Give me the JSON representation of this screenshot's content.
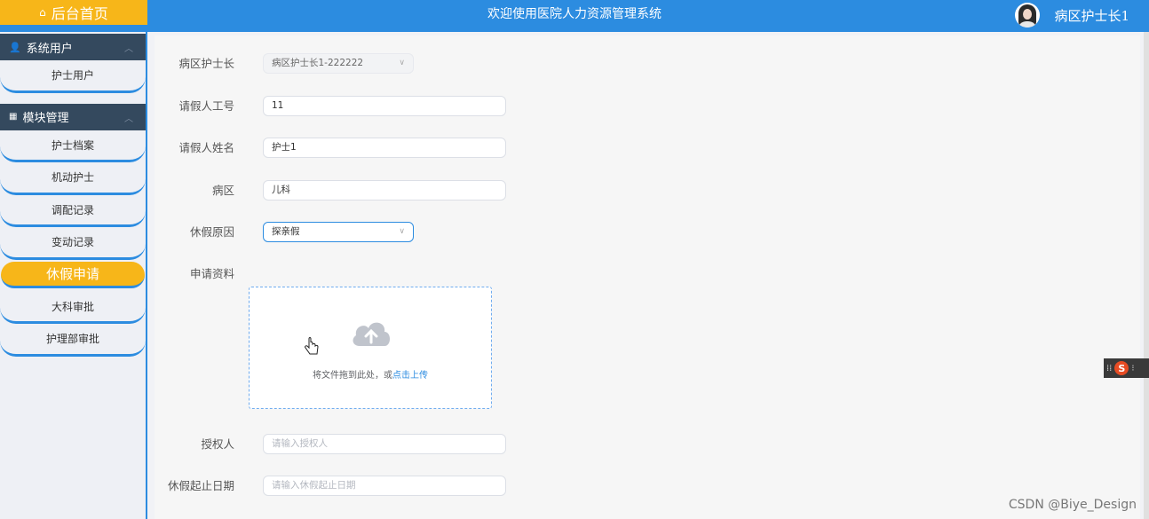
{
  "header": {
    "home_label": "后台首页",
    "welcome": "欢迎使用医院人力资源管理系统",
    "user_name": "病区护士长1"
  },
  "sidebar": {
    "groups": [
      {
        "title": "系统用户",
        "items": [
          "护士用户"
        ]
      },
      {
        "title": "模块管理",
        "items": [
          "护士档案",
          "机动护士",
          "调配记录",
          "变动记录",
          "休假申请",
          "大科审批",
          "护理部审批"
        ]
      }
    ],
    "active_item": "休假申请"
  },
  "form": {
    "fields": [
      {
        "label": "病区护士长",
        "value": "病区护士长1-222222",
        "state": "disabled",
        "type": "select"
      },
      {
        "label": "请假人工号",
        "value": "11",
        "state": "normal",
        "type": "text"
      },
      {
        "label": "请假人姓名",
        "value": "护士1",
        "state": "normal",
        "type": "text"
      },
      {
        "label": "病区",
        "value": "儿科",
        "state": "normal",
        "type": "text"
      },
      {
        "label": "休假原因",
        "value": "探亲假",
        "state": "focus",
        "type": "select"
      },
      {
        "label": "申请资料",
        "value": "",
        "state": "normal",
        "type": "upload"
      },
      {
        "label": "授权人",
        "placeholder": "请输入授权人",
        "state": "placeholder",
        "type": "text"
      },
      {
        "label": "休假起止日期",
        "placeholder": "请输入休假起止日期",
        "state": "placeholder",
        "type": "text"
      }
    ],
    "upload": {
      "text_prefix": "将文件拖到此处，或",
      "text_link": "点击上传"
    }
  },
  "ime": {
    "glyph": "S"
  },
  "watermark": "CSDN @Biye_Design"
}
